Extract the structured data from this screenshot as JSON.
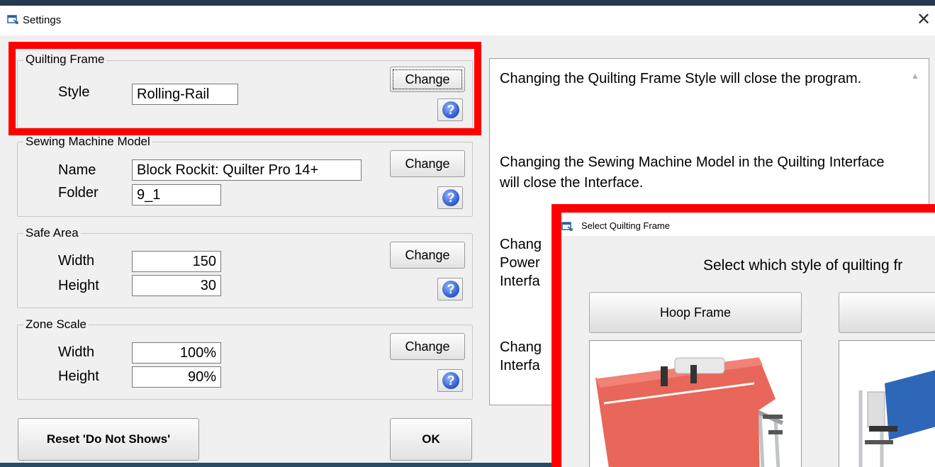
{
  "window": {
    "title": "Settings",
    "close_glyph": "✕"
  },
  "quilting_frame": {
    "legend": "Quilting Frame",
    "style_label": "Style",
    "style_value": "Rolling-Rail",
    "change_label": "Change",
    "help_glyph": "?"
  },
  "sewing_machine": {
    "legend": "Sewing Machine Model",
    "name_label": "Name",
    "name_value": "Block Rockit: Quilter Pro 14+",
    "folder_label": "Folder",
    "folder_value": "9_1",
    "change_label": "Change",
    "help_glyph": "?"
  },
  "safe_area": {
    "legend": "Safe Area",
    "width_label": "Width",
    "width_value": "150",
    "height_label": "Height",
    "height_value": "30",
    "change_label": "Change",
    "help_glyph": "?"
  },
  "zone_scale": {
    "legend": "Zone Scale",
    "width_label": "Width",
    "width_value": "100%",
    "height_label": "Height",
    "height_value": "90%",
    "change_label": "Change",
    "help_glyph": "?"
  },
  "footer": {
    "reset_label": "Reset 'Do Not Shows'",
    "ok_label": "OK"
  },
  "info_panel": {
    "para1": "Changing the Quilting Frame Style will close the program.",
    "para2": "Changing the Sewing Machine Model in the Quilting Interface will close the Interface.",
    "para3_lines": [
      "Chang",
      "Power",
      "Interfa"
    ],
    "para4_lines": [
      "Chang",
      "Interfa"
    ]
  },
  "select_dialog": {
    "title": "Select Quilting Frame",
    "prompt": "Select which style of quilting fr",
    "hoop_button_label": "Hoop Frame"
  },
  "colors": {
    "highlight": "#ff0000",
    "frame_fabric": "#e8665a",
    "alt_frame_fabric": "#2f67b8"
  },
  "icons": [
    "window-icon",
    "close-icon",
    "help-icon",
    "scroll-up-arrow-icon"
  ]
}
